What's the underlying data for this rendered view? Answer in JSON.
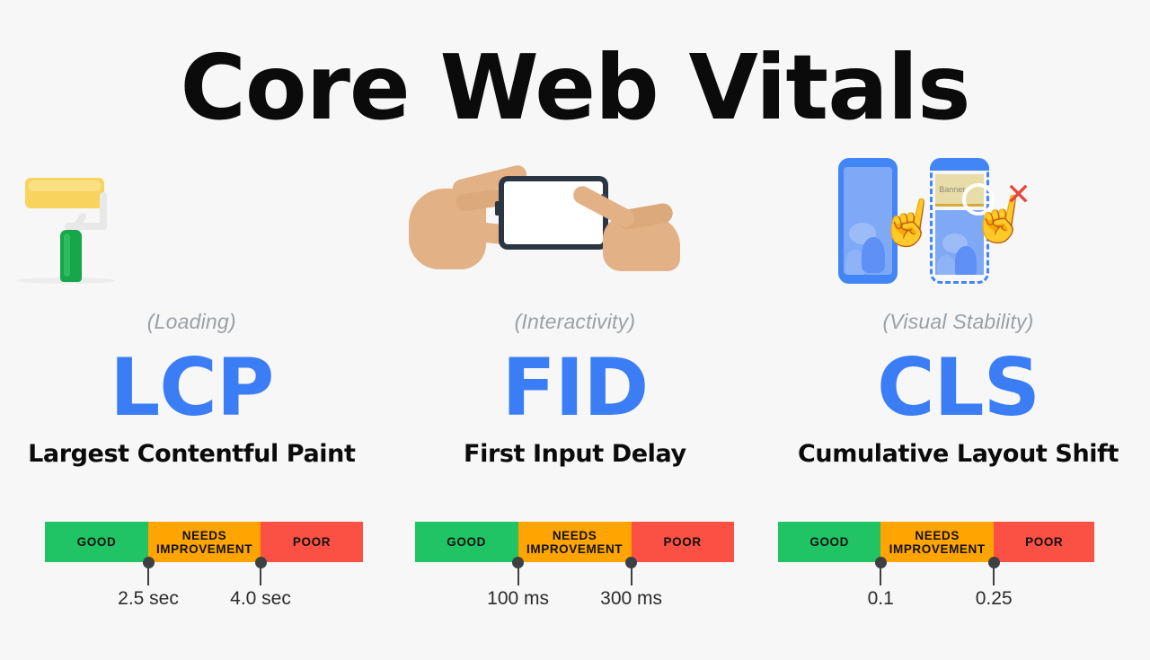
{
  "page": {
    "title": "Core Web Vitals",
    "background_color": "#F7F7F7"
  },
  "colors": {
    "accent_blue": "#3B7DF5",
    "phone_blue": "#4285F4",
    "good": "#20C464",
    "needs_improvement": "#FFA400",
    "poor": "#FB5144",
    "marker": "#3C4043",
    "subtitle_gray": "#9AA0A6",
    "banner_tan": "#E8DCA8",
    "x_red": "#E8453C"
  },
  "metrics": [
    {
      "icon_name": "paint-roller-icon",
      "subtitle": "(Loading)",
      "acronym": "LCP",
      "name": "Largest Contentful Paint",
      "bar": {
        "segments": [
          {
            "label": "GOOD",
            "color": "#20C464"
          },
          {
            "label": "NEEDS IMPROVEMENT",
            "color": "#FFA400"
          },
          {
            "label": "POOR",
            "color": "#FB5144"
          }
        ],
        "thresholds": [
          {
            "value": "2.5 sec"
          },
          {
            "value": "4.0 sec"
          }
        ]
      }
    },
    {
      "icon_name": "hands-holding-phone-icon",
      "subtitle": "(Interactivity)",
      "acronym": "FID",
      "name": "First Input Delay",
      "bar": {
        "segments": [
          {
            "label": "GOOD",
            "color": "#20C464"
          },
          {
            "label": "NEEDS IMPROVEMENT",
            "color": "#FFA400"
          },
          {
            "label": "POOR",
            "color": "#FB5144"
          }
        ],
        "thresholds": [
          {
            "value": "100 ms"
          },
          {
            "value": "300 ms"
          }
        ]
      }
    },
    {
      "icon_name": "layout-shift-phones-icon",
      "subtitle": "(Visual Stability)",
      "acronym": "CLS",
      "name": "Cumulative Layout Shift",
      "bar": {
        "segments": [
          {
            "label": "GOOD",
            "color": "#20C464"
          },
          {
            "label": "NEEDS IMPROVEMENT",
            "color": "#FFA400"
          },
          {
            "label": "POOR",
            "color": "#FB5144"
          }
        ],
        "thresholds": [
          {
            "value": "0.1"
          },
          {
            "value": "0.25"
          }
        ]
      }
    }
  ],
  "cls_icon": {
    "banner_label": "Banner",
    "x_glyph": "✕",
    "hand_glyph": "☝"
  }
}
